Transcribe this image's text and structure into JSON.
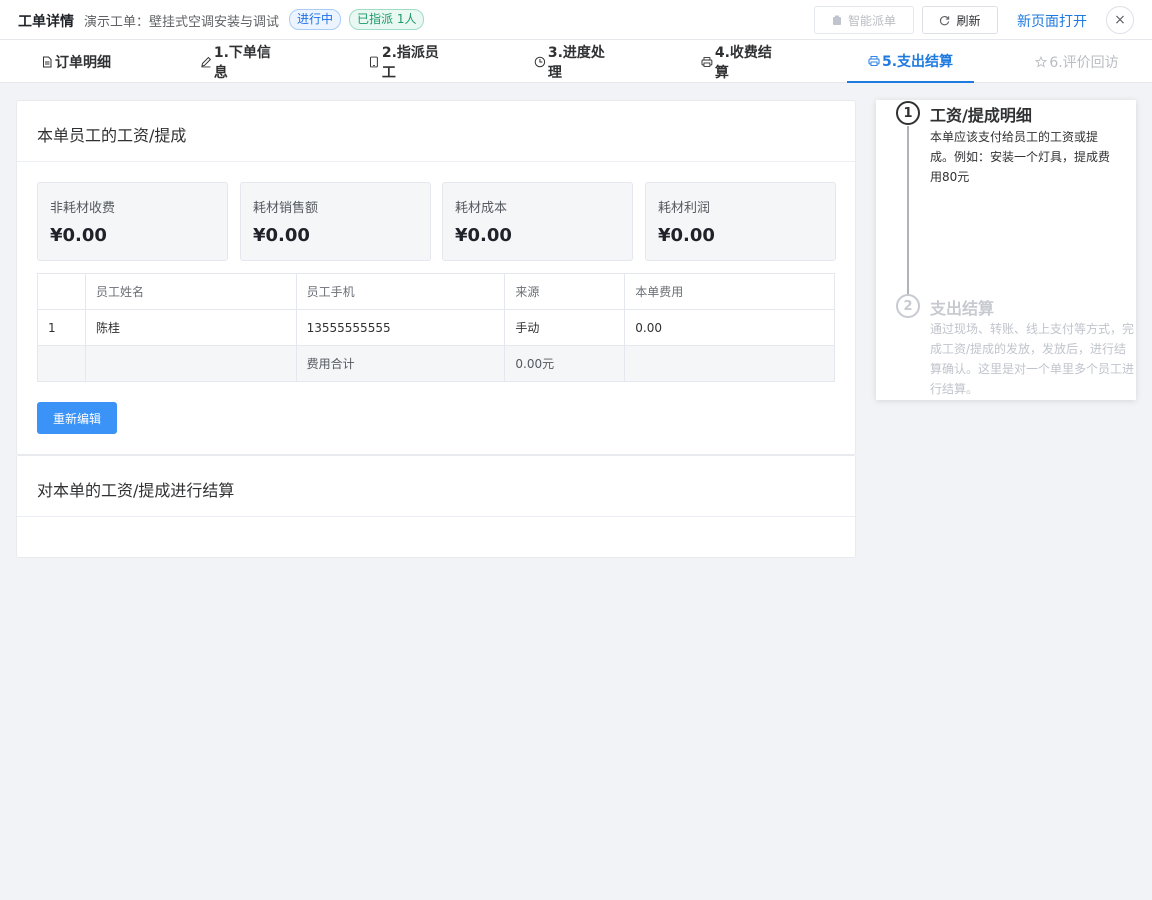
{
  "header": {
    "title": "工单详情",
    "subtitle": "演示工单：壁挂式空调安装与调试",
    "status_tag": "进行中",
    "assigned_tag": "已指派 1人",
    "smart_dispatch_label": "智能派单",
    "refresh_label": "刷新",
    "open_new_page_label": "新页面打开",
    "close_icon": "×"
  },
  "tabs": [
    {
      "label": "订单明细",
      "icon": "document-icon"
    },
    {
      "label": "1.下单信息",
      "icon": "pencil-icon"
    },
    {
      "label": "2.指派员工",
      "icon": "tablet-icon"
    },
    {
      "label": "3.进度处理",
      "icon": "clock-icon"
    },
    {
      "label": "4.收费结算",
      "icon": "printer-icon"
    },
    {
      "label": "5.支出结算",
      "icon": "printer-icon",
      "active": true
    },
    {
      "label": "6.评价回访",
      "icon": "star-icon",
      "disabled": true
    }
  ],
  "salary_card": {
    "title": "本单员工的工资/提成",
    "stats": [
      {
        "label": "非耗材收费",
        "value": "¥0.00"
      },
      {
        "label": "耗材销售额",
        "value": "¥0.00"
      },
      {
        "label": "耗材成本",
        "value": "¥0.00"
      },
      {
        "label": "耗材利润",
        "value": "¥0.00"
      }
    ],
    "table": {
      "headers": [
        "",
        "员工姓名",
        "员工手机",
        "来源",
        "本单费用"
      ],
      "rows": [
        [
          "1",
          "陈桂",
          "13555555555",
          "手动",
          "0.00"
        ]
      ],
      "summary": [
        "",
        "",
        "费用合计",
        "0.00元",
        ""
      ]
    },
    "reedit_label": "重新编辑"
  },
  "settle_card": {
    "title": "对本单的工资/提成进行结算"
  },
  "steps": [
    {
      "num": "1",
      "title": "工资/提成明细",
      "desc": "本单应该支付给员工的工资或提成。例如：安装一个灯具，提成费用80元"
    },
    {
      "num": "2",
      "title": "支出结算",
      "desc": "通过现场、转账、线上支付等方式，完成工资/提成的发放，发放后，进行结算确认。这里是对一个单里多个员工进行结算。"
    }
  ]
}
